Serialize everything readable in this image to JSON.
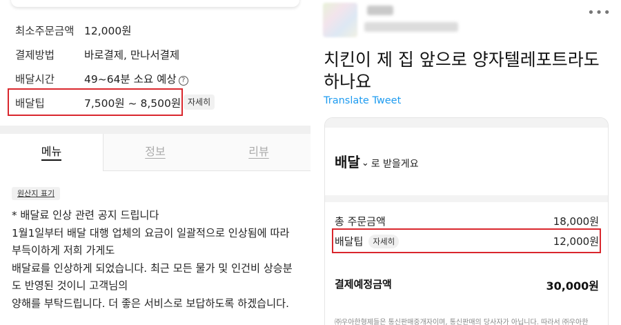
{
  "left": {
    "info_rows": [
      {
        "label": "최소주문금액",
        "value": "12,000원"
      },
      {
        "label": "결제방법",
        "value": "바로결제, 만나서결제"
      },
      {
        "label": "배달시간",
        "value": "49~64분 소요 예상"
      },
      {
        "label": "배달팁",
        "value": "7,500원 ~ 8,500원"
      }
    ],
    "help_icon": "?",
    "detail_chip": "자세히",
    "tabs": [
      "메뉴",
      "정보",
      "리뷰"
    ],
    "origin_chip": "원산지 표기",
    "notice_lines": [
      "* 배달료 인상 관련 공지 드립니다",
      "1월1일부터 배달 대행 업체의 요금이 일괄적으로 인상됨에 따라",
      "부득이하게 저희 가게도",
      "배달료를 인상하게 되었습니다. 최근 모든 물가 및 인건비 상승분",
      "도 반영된 것이니 고객님의",
      "양해를 부탁드립니다. 더 좋은 서비스로 보답하도록 하겠습니다."
    ]
  },
  "right": {
    "more_icon": "•••",
    "tweet_text": "치킨이 제 집 앞으로 양자텔레포트라도 하나요",
    "translate": "Translate Tweet",
    "delivery": {
      "big": "배달",
      "chevron": "⌄",
      "small": "로 받을게요"
    },
    "order_total_label": "총 주문금액",
    "order_total_value": "18,000원",
    "tip_label": "배달팁",
    "tip_chip": "자세히",
    "tip_value": "12,000원",
    "pay_label": "결제예정금액",
    "pay_value": "30,000원",
    "footnote": "㈜우아한형제들은 통신판매중개자이며, 통신판매의 당사자가 아닙니다. 따라서 ㈜우아한"
  },
  "colors": {
    "highlight": "#d9262c",
    "link": "#1d9bf0"
  }
}
